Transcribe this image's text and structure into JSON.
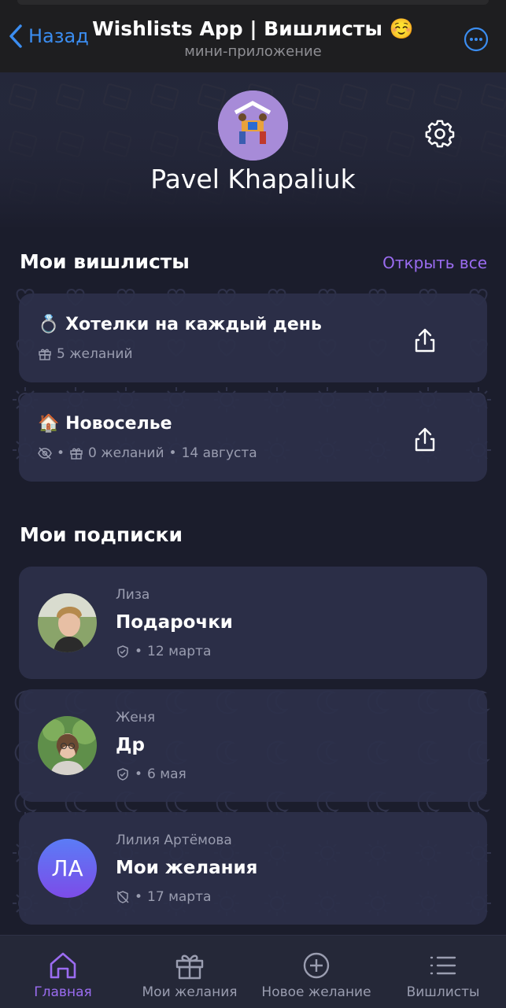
{
  "header": {
    "back_label": "Назад",
    "title": "Wishlists App | Вишлисты ☺️",
    "subtitle": "мини-приложение"
  },
  "profile": {
    "name": "Pavel Khapaliuk"
  },
  "wishlists_section": {
    "title": "Мои вишлисты",
    "open_all": "Открыть все",
    "items": [
      {
        "emoji": "💍",
        "title": "Хотелки на каждый день",
        "count": "5 желаний"
      },
      {
        "emoji": "🏠",
        "title": "Новоселье",
        "count": "0 желаний",
        "date": "14 августа"
      }
    ]
  },
  "subscriptions_section": {
    "title": "Мои подписки",
    "items": [
      {
        "owner": "Лиза",
        "title": "Подарочки",
        "date": "12 марта"
      },
      {
        "owner": "Женя",
        "title": "Др",
        "date": "6 мая"
      },
      {
        "owner": "Лилия Артёмова",
        "initials": "ЛА",
        "title": "Мои желания",
        "date": "17 марта"
      }
    ]
  },
  "tabs": [
    {
      "label": "Главная",
      "icon": "home-icon",
      "active": true
    },
    {
      "label": "Мои желания",
      "icon": "gift-icon"
    },
    {
      "label": "Новое желание",
      "icon": "plus-circle-icon"
    },
    {
      "label": "Вишлисты",
      "icon": "list-icon"
    }
  ],
  "colors": {
    "accent": "#9b6cf1",
    "link": "#3b8df0",
    "card": "#2c304a",
    "background": "#1b1d2c"
  }
}
